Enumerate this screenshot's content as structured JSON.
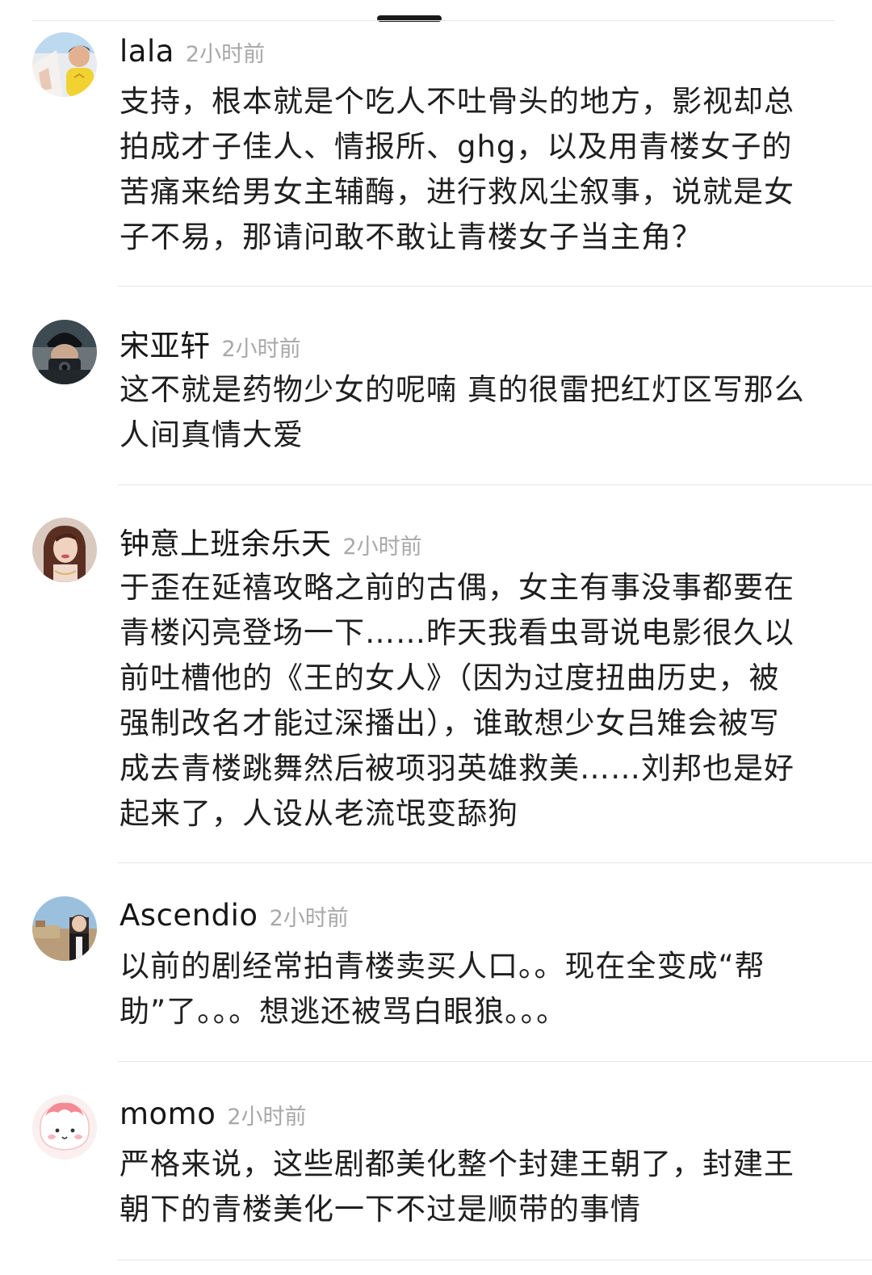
{
  "comments": [
    {
      "username": "lala",
      "time": "2小时前",
      "lines": [
        "支持，根本就是个吃人不吐骨头的地方，影视却总",
        "拍成才子佳人、情报所、ghg，以及用青楼女子的",
        "苦痛来给男女主辅酶，进行救风尘叙事，说就是女",
        "子不易，那请问敢不敢让青楼女子当主角？"
      ]
    },
    {
      "username": "宋亚轩",
      "time": "2小时前",
      "lines": [
        "这不就是药物少女的呢喃 真的很雷把红灯区写那么",
        "人间真情大爱"
      ]
    },
    {
      "username": "钟意上班余乐天",
      "time": "2小时前",
      "lines": [
        "于歪在延禧攻略之前的古偶，女主有事没事都要在",
        "青楼闪亮登场一下……昨天我看虫哥说电影很久以",
        "前吐槽他的《王的女人》（因为过度扭曲历史，被",
        "强制改名才能过深播出），谁敢想少女吕雉会被写",
        "成去青楼跳舞然后被项羽英雄救美……刘邦也是好",
        "起来了，人设从老流氓变舔狗"
      ]
    },
    {
      "username": "Ascendio",
      "time": "2小时前",
      "lines": [
        "以前的剧经常拍青楼卖买人口。。现在全变成“帮",
        "助”了。。。想逃还被骂白眼狼。。。"
      ]
    },
    {
      "username": "momo",
      "time": "2小时前",
      "lines": [
        "严格来说，这些剧都美化整个封建王朝了，封建王",
        "朝下的青楼美化一下不过是顺带的事情"
      ]
    }
  ]
}
